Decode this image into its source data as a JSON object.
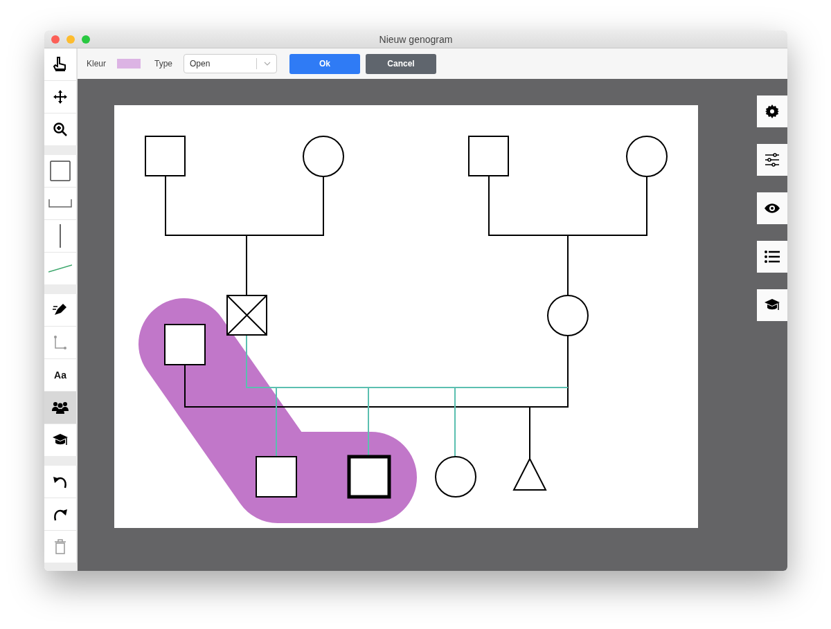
{
  "window": {
    "title": "Nieuw genogram"
  },
  "toolbar": {
    "color_label": "Kleur",
    "color": "#dcb4e4",
    "type_label": "Type",
    "type_value": "Open",
    "buttons": [
      {
        "label": "Ok",
        "kind": "primary"
      },
      {
        "label": "Cancel",
        "kind": "secondary"
      }
    ]
  },
  "tool_groups": [
    [
      {
        "kind": "pointer",
        "selected": false
      },
      {
        "kind": "move",
        "selected": false
      },
      {
        "kind": "zoom",
        "selected": false
      }
    ],
    [
      {
        "kind": "rect",
        "selected": false
      },
      {
        "kind": "bracket",
        "selected": false
      },
      {
        "kind": "vline",
        "selected": false
      },
      {
        "kind": "diagline",
        "selected": false
      }
    ],
    [
      {
        "kind": "pen",
        "selected": false
      },
      {
        "kind": "connector",
        "selected": false
      },
      {
        "kind": "text",
        "label": "Aa",
        "selected": false
      },
      {
        "kind": "family",
        "selected": true
      },
      {
        "kind": "education",
        "selected": false
      }
    ],
    [
      {
        "kind": "undo",
        "selected": false
      },
      {
        "kind": "redo",
        "selected": false
      },
      {
        "kind": "delete",
        "selected": false
      }
    ]
  ],
  "side_buttons": [
    {
      "kind": "settings"
    },
    {
      "kind": "sliders"
    },
    {
      "kind": "eye"
    },
    {
      "kind": "list"
    },
    {
      "kind": "education"
    }
  ]
}
